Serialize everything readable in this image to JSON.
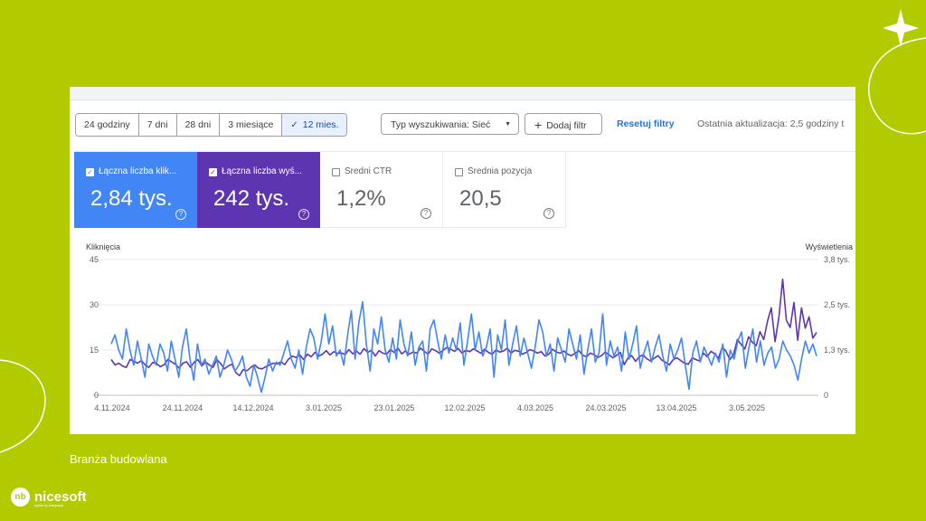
{
  "date_ranges": [
    {
      "label": "24 godziny",
      "active": false
    },
    {
      "label": "7 dni",
      "active": false
    },
    {
      "label": "28 dni",
      "active": false
    },
    {
      "label": "3 miesiące",
      "active": false
    },
    {
      "label": "12 mies.",
      "active": true
    }
  ],
  "filters": {
    "search_type": "Typ wyszukiwania: Sieć",
    "add_filter": "Dodaj filtr",
    "reset": "Resetuj filtry",
    "last_update": "Ostatnia aktualizacja: 2,5 godziny t"
  },
  "metrics": [
    {
      "label": "Łączna liczba klik...",
      "value": "2,84 tys.",
      "checked": true,
      "color": "#4285f4"
    },
    {
      "label": "Łączna liczba wyś...",
      "value": "242 tys.",
      "checked": true,
      "color": "#5e35b1"
    },
    {
      "label": "Średni CTR",
      "value": "1,2%",
      "checked": false
    },
    {
      "label": "Średnia pozycja",
      "value": "20,5",
      "checked": false
    }
  ],
  "chart_data": {
    "type": "line",
    "left_axis_title": "Kliknięcia",
    "right_axis_title": "Wyświetlenia",
    "left_ticks": [
      "45",
      "30",
      "15",
      "0"
    ],
    "right_ticks": [
      "3,8 tys.",
      "2,5 tys.",
      "1,3 tys.",
      "0"
    ],
    "ylim_left": [
      0,
      45
    ],
    "ylim_right": [
      0,
      3800
    ],
    "x_ticks": [
      "4.11.2024",
      "24.11.2024",
      "14.12.2024",
      "3.01.2025",
      "23.01.2025",
      "12.02.2025",
      "4.03.2025",
      "24.03.2025",
      "13.04.2025",
      "3.05.2025"
    ],
    "x_start": "2024-11-04",
    "x_end": "2025-05-27",
    "series": [
      {
        "name": "Kliknięcia",
        "axis": "left",
        "color": "#4285f4",
        "values": [
          17,
          20,
          15,
          12,
          22,
          15,
          10,
          18,
          12,
          6,
          17,
          13,
          10,
          17,
          14,
          8,
          18,
          12,
          6,
          16,
          22,
          12,
          5,
          17,
          10,
          12,
          7,
          10,
          13,
          6,
          10,
          15,
          12,
          8,
          10,
          13,
          6,
          3,
          10,
          6,
          1,
          6,
          12,
          8,
          11,
          10,
          14,
          18,
          12,
          9,
          15,
          7,
          16,
          22,
          19,
          12,
          18,
          27,
          17,
          23,
          13,
          15,
          10,
          20,
          28,
          12,
          24,
          31,
          17,
          8,
          22,
          17,
          26,
          15,
          11,
          19,
          12,
          25,
          17,
          13,
          21,
          10,
          16,
          18,
          8,
          22,
          25,
          18,
          12,
          20,
          14,
          19,
          15,
          24,
          10,
          18,
          27,
          15,
          21,
          13,
          16,
          22,
          6,
          20,
          15,
          25,
          10,
          17,
          23,
          13,
          19,
          14,
          9,
          16,
          25,
          21,
          13,
          17,
          8,
          19,
          15,
          11,
          22,
          17,
          12,
          20,
          7,
          15,
          22,
          11,
          14,
          27,
          10,
          18,
          13,
          16,
          8,
          21,
          12,
          17,
          23,
          9,
          14,
          18,
          11,
          16,
          20,
          13,
          8,
          17,
          12,
          15,
          19,
          10,
          2,
          14,
          18,
          11,
          16,
          13,
          10,
          14,
          11,
          17,
          6,
          15,
          12,
          18,
          21,
          9,
          16,
          22,
          11,
          18,
          10,
          14,
          16,
          9,
          12,
          18,
          15,
          13,
          10,
          5,
          12,
          18,
          14,
          17,
          13
        ],
        "values_note": ""
      },
      {
        "name": "Wyświetlenia",
        "axis": "right",
        "color": "#5e35b1",
        "values": [
          1000,
          850,
          900,
          820,
          780,
          1000,
          950,
          900,
          970,
          850,
          780,
          920,
          890,
          800,
          850,
          1000,
          940,
          870,
          760,
          900,
          940,
          780,
          930,
          1000,
          820,
          930,
          850,
          780,
          1000,
          890,
          740,
          820,
          870,
          640,
          550,
          720,
          690,
          780,
          850,
          760,
          740,
          800,
          850,
          900,
          880,
          940,
          860,
          1010,
          1100,
          1060,
          1130,
          1000,
          1150,
          1080,
          1200,
          1100,
          1150,
          1250,
          1130,
          1220,
          1170,
          1190,
          1140,
          1280,
          1160,
          1240,
          1150,
          1310,
          1200,
          1260,
          1100,
          1250,
          1180,
          1150,
          1280,
          1200,
          1320,
          1160,
          1240,
          1150,
          1210,
          1180,
          1320,
          1230,
          1150,
          1300,
          1250,
          1180,
          1260,
          1340,
          1290,
          1230,
          1310,
          1180,
          1260,
          1220,
          1300,
          1240,
          1180,
          1290,
          1200,
          1150,
          1270,
          1210,
          1240,
          1320,
          1180,
          1260,
          1230,
          1150,
          1200,
          1280,
          1240,
          1180,
          1220,
          1100,
          1150,
          1290,
          1210,
          1180,
          1240,
          1150,
          1110,
          1180,
          1250,
          1120,
          1080,
          1180,
          1140,
          1060,
          1110,
          1210,
          1130,
          1050,
          1120,
          1200,
          860,
          1040,
          1110,
          950,
          1080,
          1130,
          1020,
          960,
          1040,
          1110,
          980,
          920,
          850,
          1000,
          1050,
          970,
          900,
          870,
          1050,
          1000,
          960,
          1180,
          1080,
          1230,
          1160,
          1040,
          1350,
          1230,
          1000,
          1140,
          1560,
          1420,
          1300,
          1640,
          1480,
          1390,
          1780,
          1560,
          2080,
          2450,
          1500,
          2180,
          3250,
          2100,
          1900,
          2600,
          1540,
          2450,
          1880,
          2200,
          1600,
          1760
        ]
      }
    ]
  },
  "caption": "Branża budowlana",
  "brand": {
    "name": "nicesoft",
    "tagline": "systemy integracji",
    "mark": "nb"
  },
  "colors": {
    "background": "#b2cb00",
    "clicks": "#4285f4",
    "impressions": "#5e35b1",
    "link": "#1a73e8"
  }
}
